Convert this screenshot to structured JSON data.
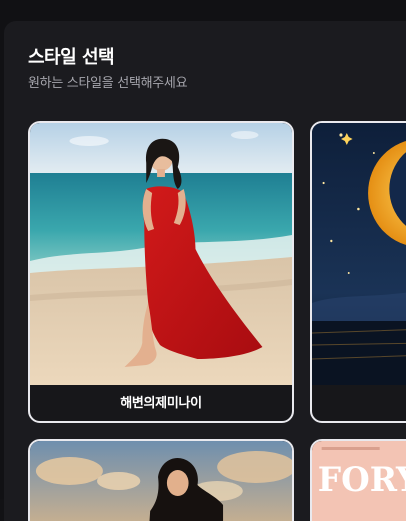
{
  "dialog": {
    "title": "스타일 선택",
    "subtitle": "원하는 스타일을 선택해주세요"
  },
  "styles": [
    {
      "label": "해변의제미나이",
      "selected": true
    },
    {
      "label": "",
      "selected": false
    },
    {
      "label": "",
      "selected": false
    },
    {
      "label": "",
      "selected": false
    }
  ],
  "poster_text": "FORY"
}
